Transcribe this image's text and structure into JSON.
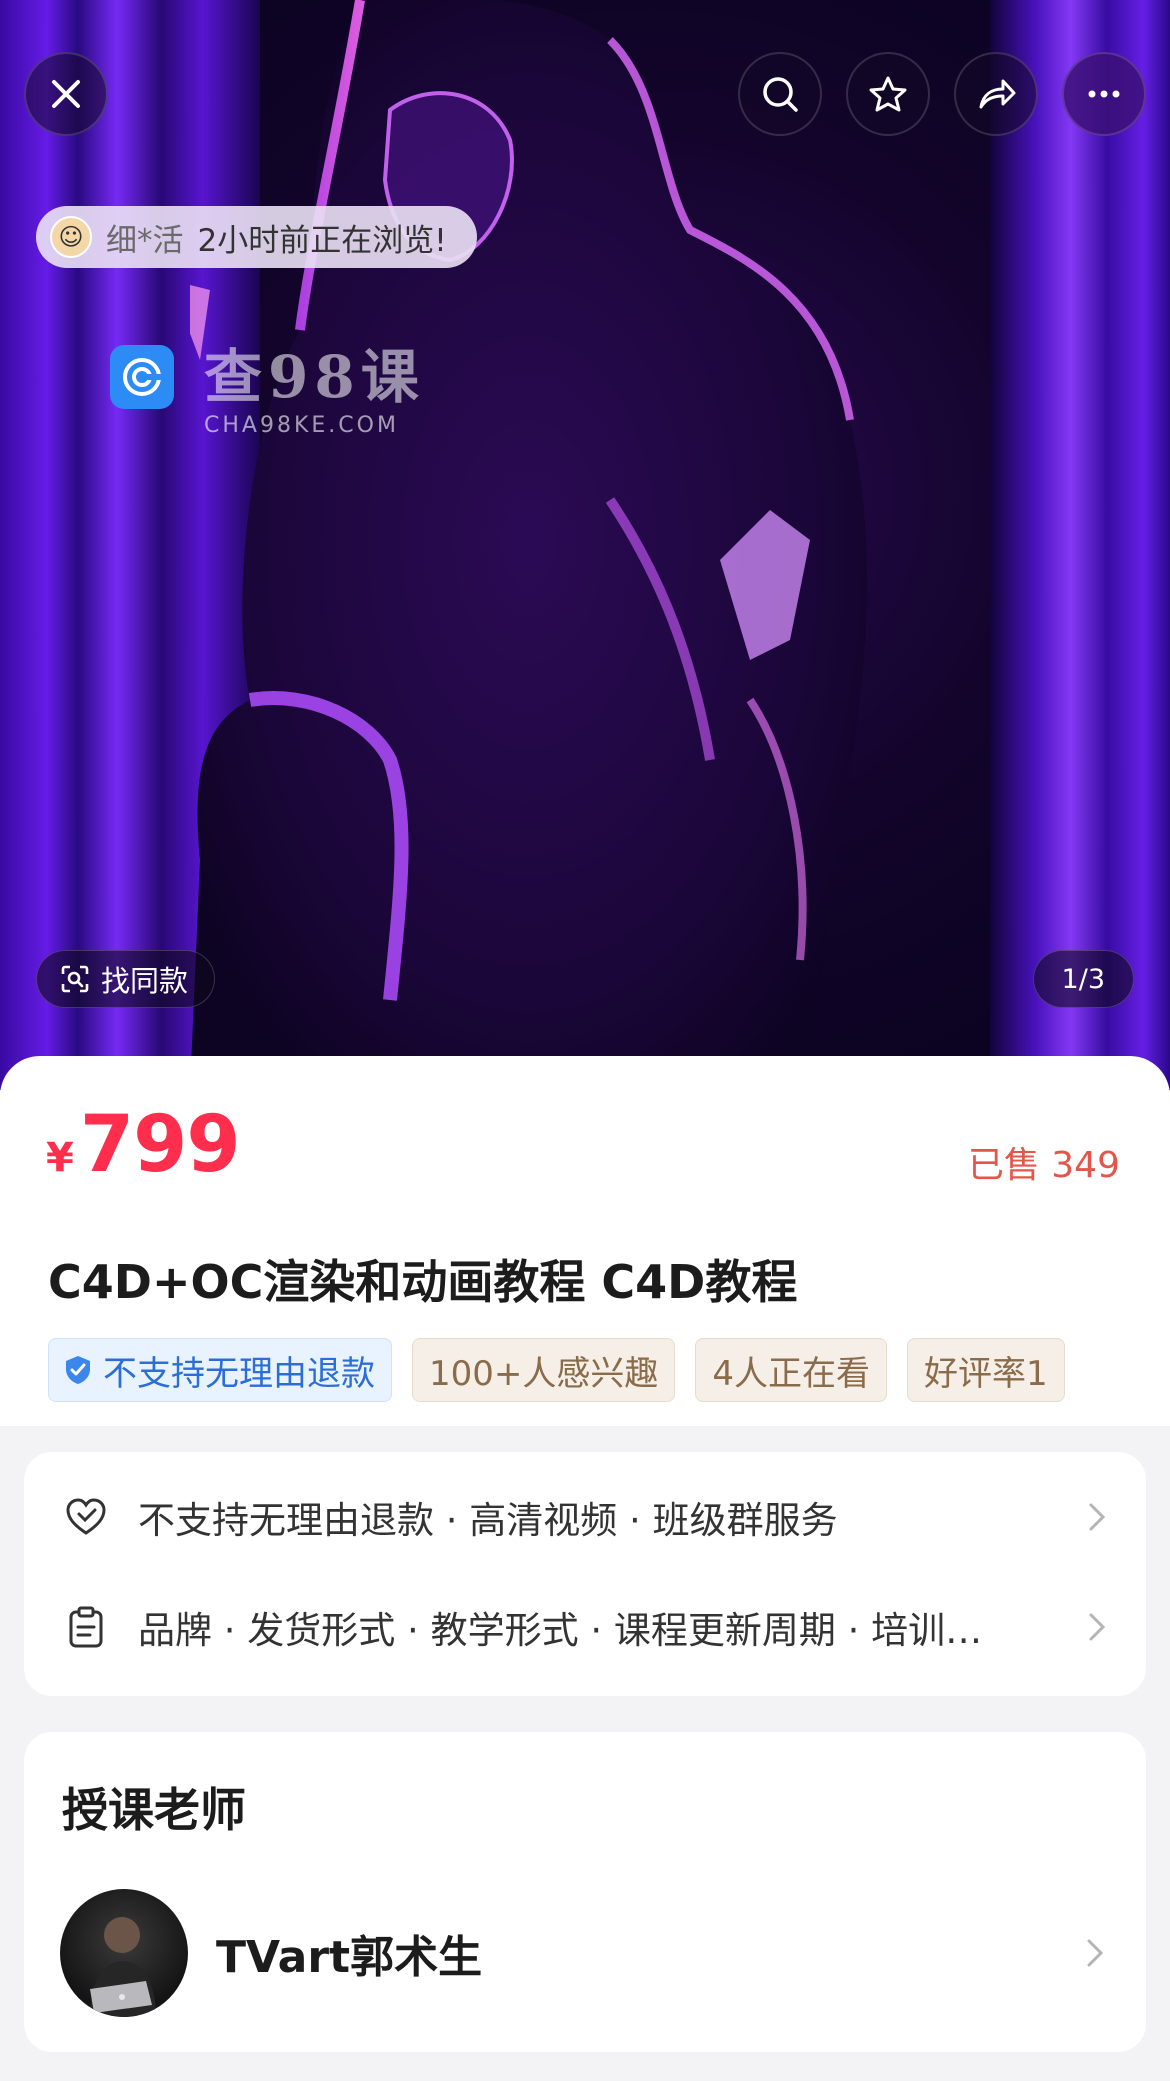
{
  "hero": {
    "browse_user": "细*活",
    "browse_text": "2小时前正在浏览!",
    "watermark_cn": "查98课",
    "watermark_en": "CHA98KE.COM",
    "find_similar_label": "找同款",
    "pager": "1/3",
    "icons": [
      "close-icon",
      "search-icon",
      "star-icon",
      "share-icon",
      "more-icon"
    ]
  },
  "product": {
    "currency": "¥",
    "price": "799",
    "sold": "已售 349",
    "title": "C4D+OC渲染和动画教程 C4D教程",
    "tags": [
      {
        "label": "不支持无理由退款",
        "style": "blue"
      },
      {
        "label": "100+人感兴趣",
        "style": "beige"
      },
      {
        "label": "4人正在看",
        "style": "beige"
      },
      {
        "label": "好评率1",
        "style": "beige"
      }
    ],
    "colors": {
      "price": "#ff2e4d",
      "sold": "#e2564b",
      "tag_blue": "#2b6fd6"
    }
  },
  "services": {
    "guarantee": "不支持无理由退款 · 高清视频 · 班级群服务",
    "params": "品牌 · 发货形式 · 教学形式 · 课程更新周期 · 培训…"
  },
  "teacher": {
    "section_title": "授课老师",
    "name": "TVart郭术生"
  }
}
